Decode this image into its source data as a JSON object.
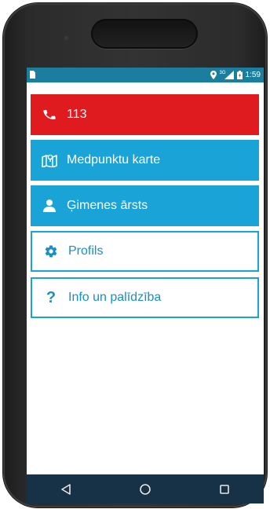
{
  "status_bar": {
    "network": "3G",
    "time": "1:59"
  },
  "menu": {
    "emergency": {
      "label": "113",
      "icon": "phone-icon",
      "color": "#df1b1f"
    },
    "map": {
      "label": "Medpunktu karte",
      "icon": "map-icon",
      "color": "#1aa3d6"
    },
    "doctor": {
      "label": "Ģimenes ārsts",
      "icon": "user-icon",
      "color": "#1aa3d6"
    },
    "profile": {
      "label": "Profils",
      "icon": "gear-icon",
      "color": "#1aa3d6"
    },
    "help": {
      "label": "Info un palīdzība",
      "icon": "question-icon",
      "color": "#1aa3d6"
    }
  },
  "nav_bar": {
    "back": "back-icon",
    "home": "home-icon",
    "recents": "recents-icon"
  }
}
